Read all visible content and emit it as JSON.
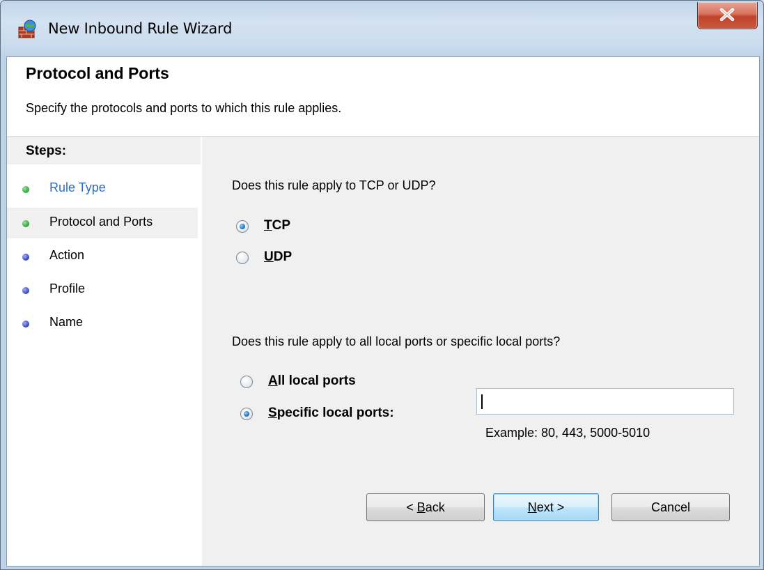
{
  "window": {
    "title": "New Inbound Rule Wizard",
    "icon": "firewall-icon",
    "close_icon": "close-icon"
  },
  "header": {
    "title": "Protocol and Ports",
    "subtitle": "Specify the protocols and ports to which this rule applies."
  },
  "steps": {
    "heading": "Steps:",
    "items": [
      {
        "label": "Rule Type",
        "status": "completed",
        "color": "#2a6cc4"
      },
      {
        "label": "Protocol and Ports",
        "status": "current",
        "color": "#000000"
      },
      {
        "label": "Action",
        "status": "pending",
        "color": "#000000"
      },
      {
        "label": "Profile",
        "status": "pending",
        "color": "#000000"
      },
      {
        "label": "Name",
        "status": "pending",
        "color": "#000000"
      }
    ]
  },
  "protocol": {
    "question": "Does this rule apply to TCP or UDP?",
    "options": [
      {
        "label": "TCP",
        "accel": "T",
        "rest": "CP",
        "selected": true
      },
      {
        "label": "UDP",
        "accel": "U",
        "rest": "DP",
        "selected": false
      }
    ]
  },
  "ports": {
    "question": "Does this rule apply to all local ports or specific local ports?",
    "options": [
      {
        "label": "All local ports",
        "accel": "A",
        "rest": "ll local ports",
        "selected": false
      },
      {
        "label": "Specific local ports:",
        "accel": "S",
        "rest": "pecific local ports:",
        "selected": true
      }
    ],
    "input_value": "",
    "example": "Example: 80, 443, 5000-5010"
  },
  "buttons": {
    "back": {
      "accel": "B",
      "pre": "< ",
      "rest": "ack"
    },
    "next": {
      "accel": "N",
      "pre": "",
      "rest": "ext >"
    },
    "cancel": "Cancel"
  },
  "colors": {
    "completed_dot": "#3fae49",
    "pending_dot": "#4a55c8",
    "link_blue": "#2a6cc4"
  }
}
